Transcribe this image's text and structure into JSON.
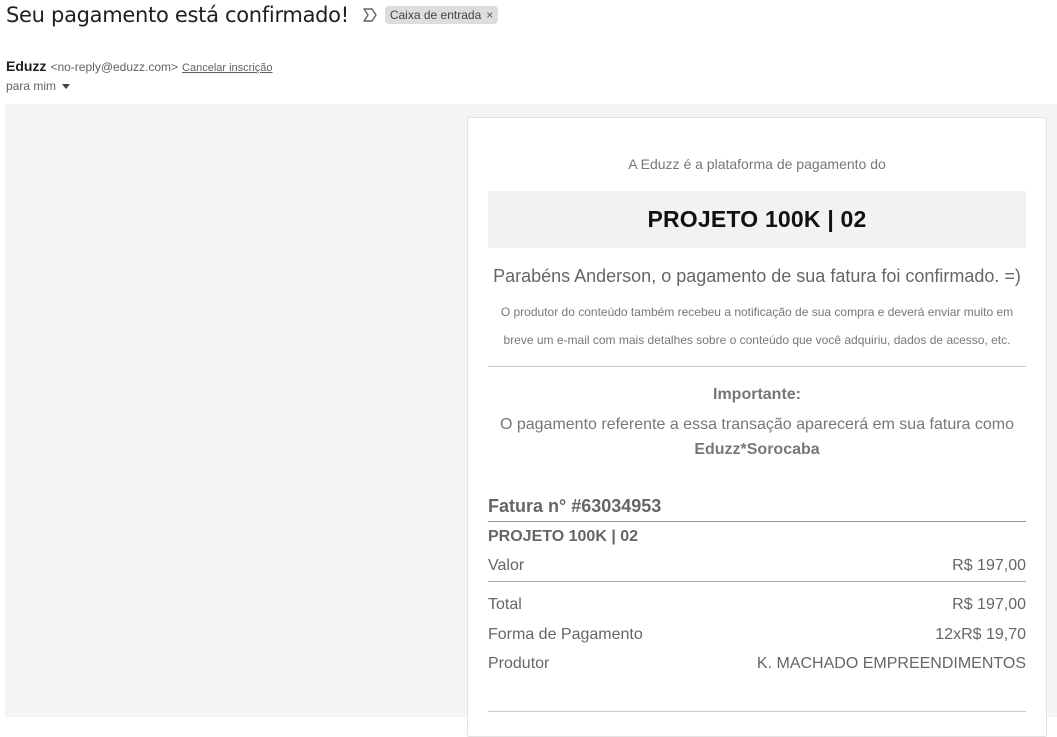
{
  "email": {
    "subject": "Seu pagamento está confirmado!",
    "label": "Caixa de entrada",
    "label_close": "×",
    "sender_name": "Eduzz",
    "sender_email": "<no-reply@eduzz.com>",
    "unsubscribe": "Cancelar inscrição",
    "to": "para mim"
  },
  "message": {
    "intro": "A Eduzz é a plataforma de pagamento do",
    "product_name": "PROJETO 100K | 02",
    "congrats": "Parabéns Anderson, o pagamento de sua fatura foi confirmado. =)",
    "notice_line1": "O produtor do conteúdo também recebeu a notificação de sua compra e deverá enviar muito em",
    "notice_line2": "breve um e-mail com mais detalhes sobre o conteúdo que você adquiriu, dados de acesso, etc.",
    "important_title": "Importante:",
    "important_text": "O pagamento referente a essa transação aparecerá em sua fatura como",
    "statement_name": "Eduzz*Sorocaba"
  },
  "invoice": {
    "title": "Fatura n° #63034953",
    "product": "PROJETO 100K | 02",
    "rows": [
      {
        "label": "Valor",
        "value": "R$ 197,00"
      },
      {
        "label": "Total",
        "value": "R$ 197,00"
      },
      {
        "label": "Forma de Pagamento",
        "value": "12xR$ 19,70"
      },
      {
        "label": "Produtor",
        "value": "K. MACHADO EMPREENDIMENTOS"
      }
    ]
  }
}
